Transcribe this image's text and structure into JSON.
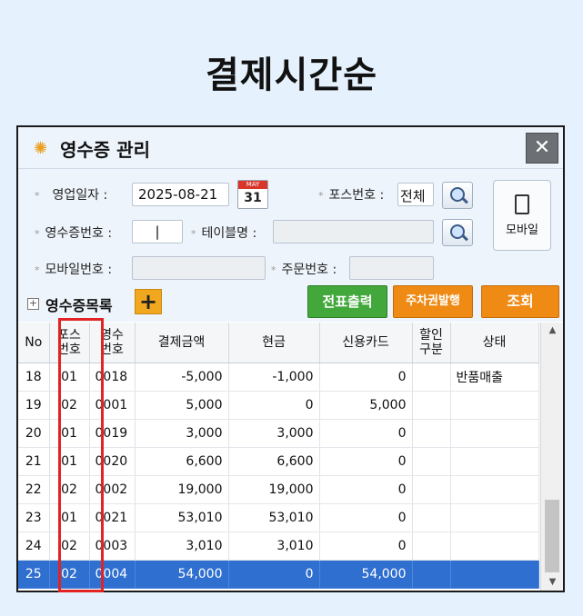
{
  "page": {
    "heading": "결제시간순"
  },
  "window": {
    "title": "영수증 관리",
    "close_label": "✕"
  },
  "filters": {
    "business_date_label": "영업일자 :",
    "business_date_value": "2025-08-21",
    "calendar": {
      "month": "MAY",
      "day": "31"
    },
    "pos_no_label": "포스번호 :",
    "pos_no_value": "전체",
    "receipt_no_label": "영수증번호 :",
    "receipt_no_value": "|",
    "table_name_label": "테이블명 :",
    "table_name_value": "",
    "mobile_no_label": "모바일번호 :",
    "mobile_no_value": "",
    "order_no_label": "주문번호 :",
    "order_no_value": "",
    "mobile_button_label": "모바일"
  },
  "list": {
    "title": "영수증목록",
    "plus_label": "+",
    "print_slip_label": "전표출력",
    "parking_ticket_label": "주차권발행",
    "search_label": "조회"
  },
  "grid": {
    "columns": [
      "No",
      "포스\n번호",
      "영수\n번호",
      "결제금액",
      "현금",
      "신용카드",
      "할인\n구분",
      "상태"
    ],
    "rows": [
      [
        "18",
        "01",
        "0018",
        "-5,000",
        "-1,000",
        "0",
        "",
        "반품매출"
      ],
      [
        "19",
        "02",
        "0001",
        "5,000",
        "0",
        "5,000",
        "",
        ""
      ],
      [
        "20",
        "01",
        "0019",
        "3,000",
        "3,000",
        "0",
        "",
        ""
      ],
      [
        "21",
        "01",
        "0020",
        "6,600",
        "6,600",
        "0",
        "",
        ""
      ],
      [
        "22",
        "02",
        "0002",
        "19,000",
        "19,000",
        "0",
        "",
        ""
      ],
      [
        "23",
        "01",
        "0021",
        "53,010",
        "53,010",
        "0",
        "",
        ""
      ],
      [
        "24",
        "02",
        "0003",
        "3,010",
        "3,010",
        "0",
        "",
        ""
      ],
      [
        "25",
        "02",
        "0004",
        "54,000",
        "0",
        "54,000",
        "",
        ""
      ]
    ],
    "selected_row": 7,
    "highlighted_column": "포스번호"
  },
  "colors": {
    "selected_row": "#2f6fd0",
    "highlight_box": "#e32323",
    "green_button": "#43a83b",
    "orange_button": "#ef8a14"
  }
}
